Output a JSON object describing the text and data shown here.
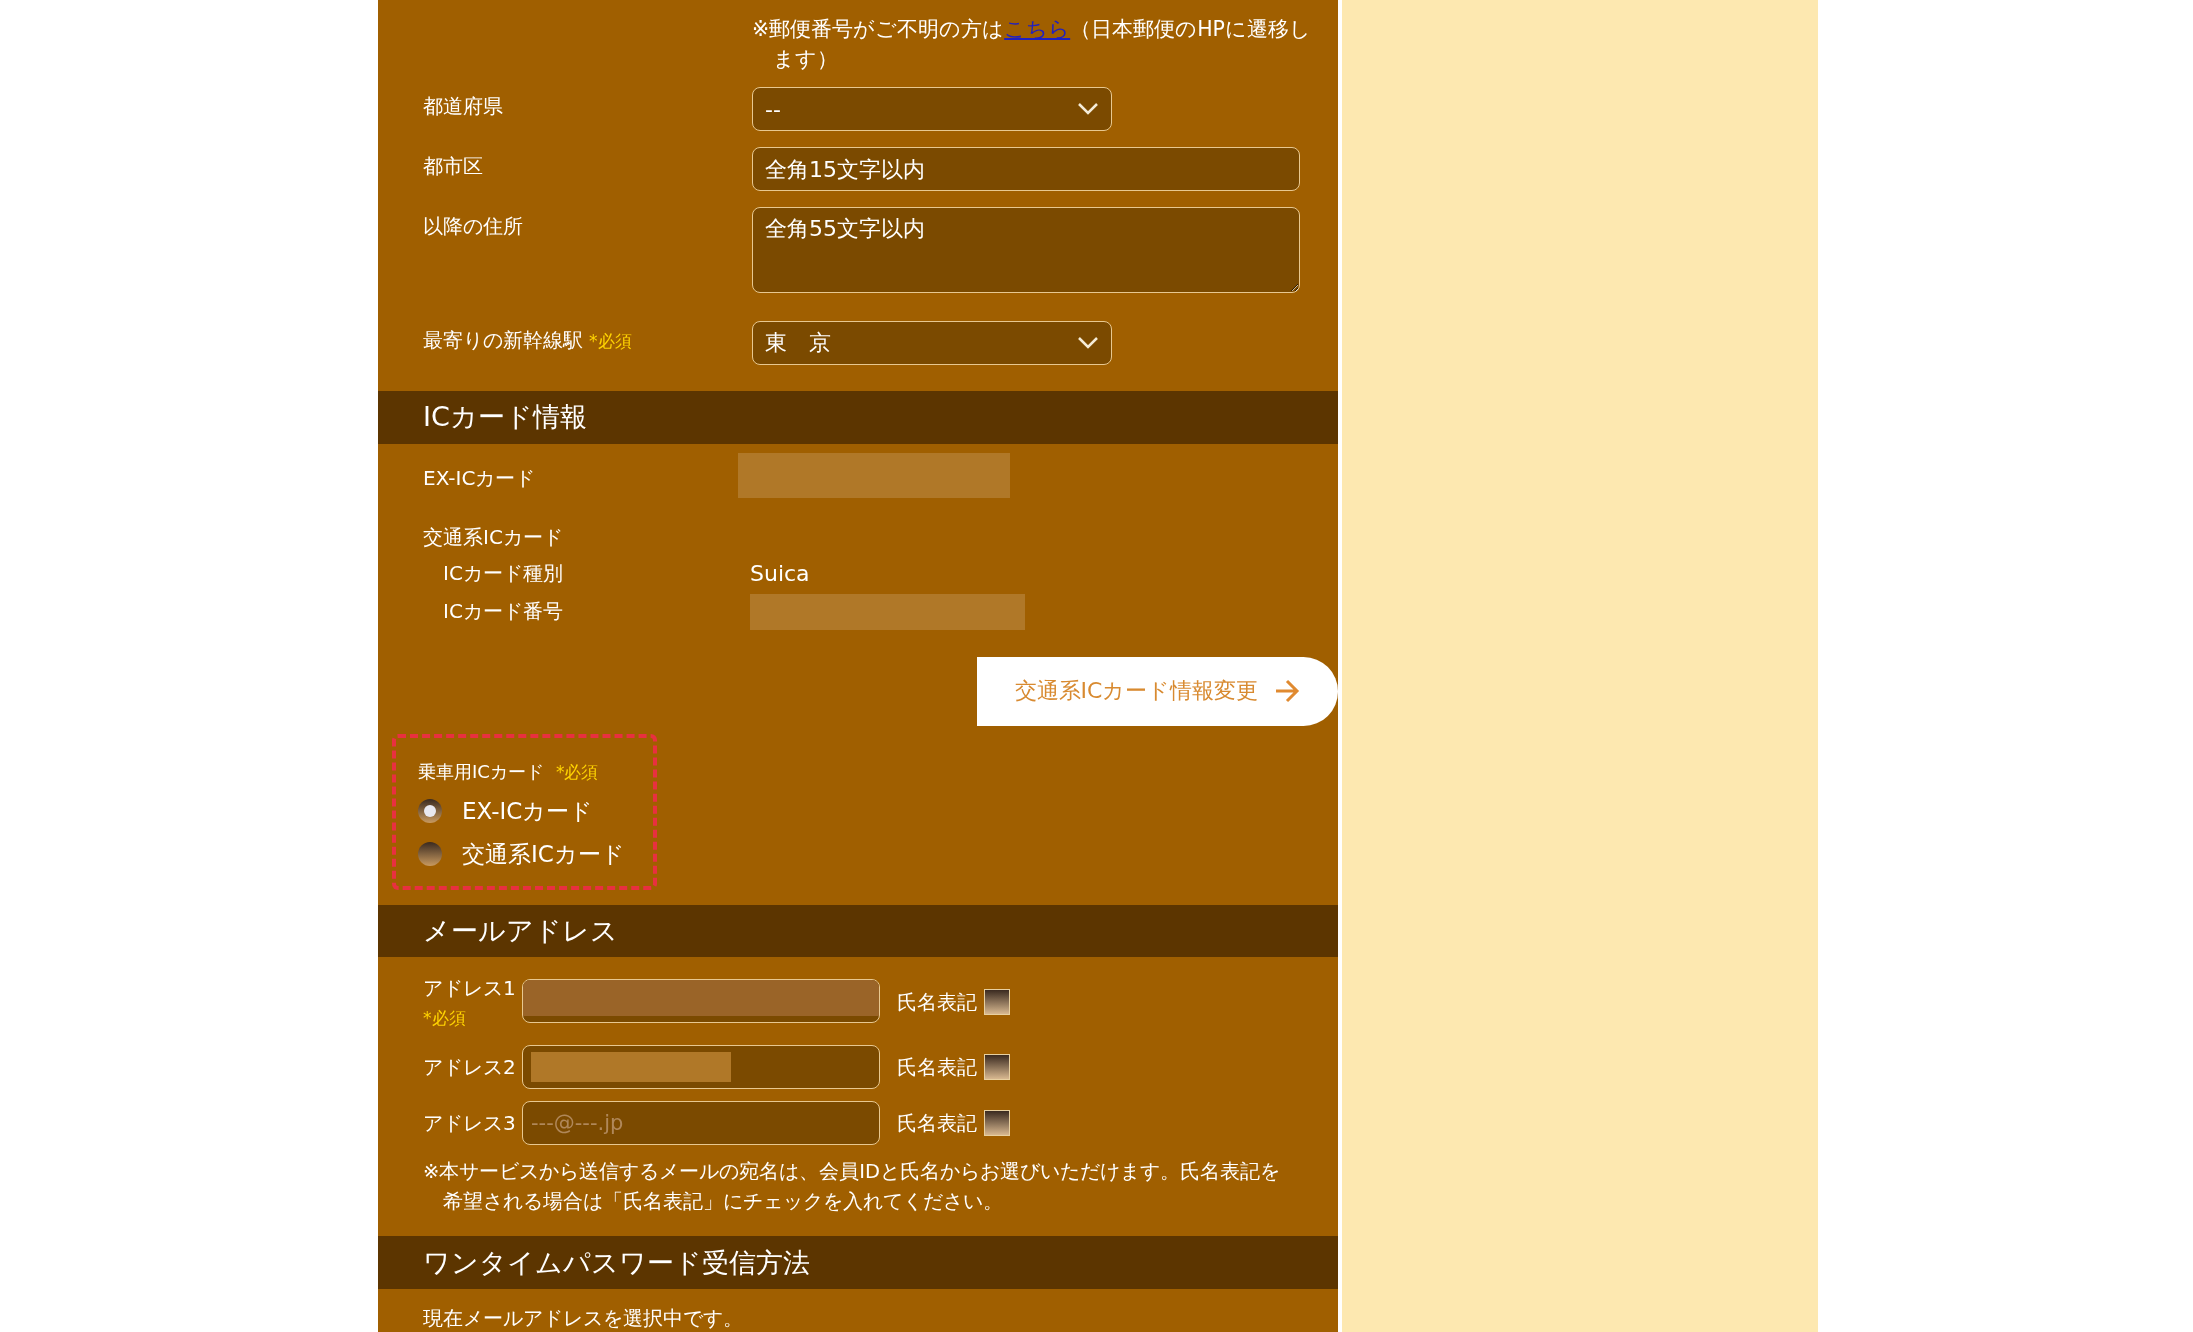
{
  "address_section": {
    "postal_note": {
      "text_before": "※郵便番号がご不明の方は",
      "link": "こちら",
      "text_after": "（日本郵便のHPに遷移します）"
    },
    "fields": [
      {
        "kind": "select",
        "label": "都道府県",
        "value": "--"
      },
      {
        "kind": "input",
        "label": "都市区",
        "placeholder": "全角15文字以内"
      },
      {
        "kind": "textarea",
        "label": "以降の住所",
        "placeholder": "全角55文字以内"
      },
      {
        "kind": "select",
        "label": "最寄りの新幹線駅",
        "required": "*必須",
        "value": "東　京"
      }
    ]
  },
  "ic_card_section": {
    "title": "ICカード情報",
    "ex_ic_label": "EX-ICカード",
    "transit_label": "交通系ICカード",
    "transit_rows": [
      {
        "label": "ICカード種別",
        "value": "Suica"
      },
      {
        "label": "ICカード番号",
        "redacted": true
      }
    ],
    "change_button": "交通系ICカード情報変更",
    "boarding_card": {
      "label": "乗車用ICカード",
      "required": "*必須",
      "options": [
        {
          "label": "EX-ICカード",
          "selected": true
        },
        {
          "label": "交通系ICカード",
          "selected": false
        }
      ]
    }
  },
  "email_section": {
    "title": "メールアドレス",
    "addresses": [
      {
        "label": "アドレス1",
        "required": "*必須",
        "redacted": true,
        "checkbox_label": "氏名表記",
        "checked": false
      },
      {
        "label": "アドレス2",
        "redacted": true,
        "checkbox_label": "氏名表記",
        "checked": false
      },
      {
        "label": "アドレス3",
        "placeholder": "---@---.jp",
        "checkbox_label": "氏名表記",
        "checked": false
      }
    ],
    "note": "※本サービスから送信するメールの宛名は、会員IDと氏名からお選びいただけます。氏名表記を希望される場合は「氏名表記」にチェックを入れてください。"
  },
  "otp_section": {
    "title": "ワンタイムパスワード受信方法",
    "status": "現在メールアドレスを選択中です。"
  }
}
